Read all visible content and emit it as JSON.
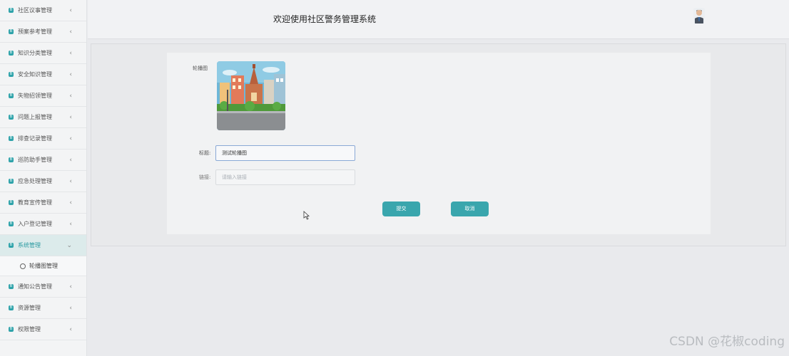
{
  "sidebar": {
    "items": [
      {
        "label": "社区议事管理"
      },
      {
        "label": "预案参考管理"
      },
      {
        "label": "知识分类管理"
      },
      {
        "label": "安全知识管理"
      },
      {
        "label": "失物招领管理"
      },
      {
        "label": "问题上报管理"
      },
      {
        "label": "排查记录管理"
      },
      {
        "label": "巡防助手管理"
      },
      {
        "label": "应急处理管理"
      },
      {
        "label": "教育宣传管理"
      },
      {
        "label": "入户登记管理"
      }
    ],
    "active_item": {
      "label": "系统管理",
      "chevron": "⌄"
    },
    "submenu_item": {
      "label": "轮播图管理"
    },
    "items_after": [
      {
        "label": "通知公告管理"
      },
      {
        "label": "资源管理"
      },
      {
        "label": "权限管理"
      }
    ],
    "chevron_collapsed": "‹",
    "badge_glyph": "B",
    "accent_color": "#2fa3aa"
  },
  "header": {
    "title": "欢迎使用社区警务管理系统"
  },
  "form": {
    "carousel_label": "轮播图",
    "title_label": "标题:",
    "title_value": "测试轮播图",
    "link_label": "链接:",
    "link_placeholder": "请输入链接",
    "submit_label": "提交",
    "cancel_label": "取消",
    "button_color": "#3aa6ad"
  },
  "watermark": "CSDN @花椒coding"
}
